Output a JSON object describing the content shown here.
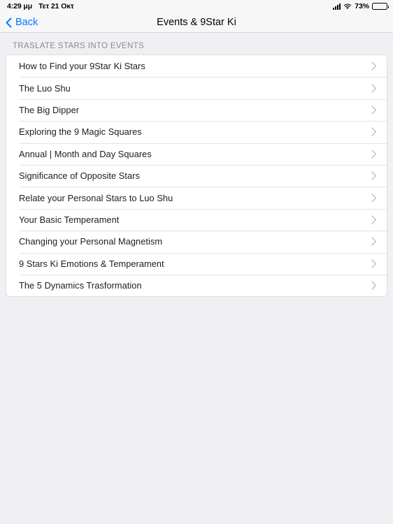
{
  "status_bar": {
    "time": "4:29 μμ",
    "date": "Τετ 21 Οκτ",
    "battery_percent": "73%",
    "battery_level": 73,
    "signal_icon": "cellular-signal-icon",
    "wifi_icon": "wifi-icon",
    "battery_icon": "battery-icon"
  },
  "nav": {
    "back_label": "Back",
    "back_icon": "chevron-left-icon",
    "title": "Events & 9Star Ki",
    "accent_color": "#007aff"
  },
  "section": {
    "header": "TRASLATE STARS INTO EVENTS",
    "rows": [
      {
        "label": "How to Find your 9Star Ki Stars"
      },
      {
        "label": "The Luo Shu"
      },
      {
        "label": "The Big Dipper"
      },
      {
        "label": "Exploring the 9 Magic Squares"
      },
      {
        "label": "Annual | Month and Day Squares"
      },
      {
        "label": "Significance of Opposite Stars"
      },
      {
        "label": "Relate your Personal Stars to Luo Shu"
      },
      {
        "label": "Your Basic Temperament"
      },
      {
        "label": "Changing your Personal Magnetism"
      },
      {
        "label": "9 Stars Ki Emotions & Temperament"
      },
      {
        "label": "The 5 Dynamics Trasformation"
      }
    ],
    "row_accessory_icon": "chevron-right-icon"
  },
  "colors": {
    "background": "#efeff4",
    "card": "#ffffff",
    "separator": "#e3e3e5",
    "text": "#1c1c1e",
    "secondary_text": "#8b8b90"
  }
}
